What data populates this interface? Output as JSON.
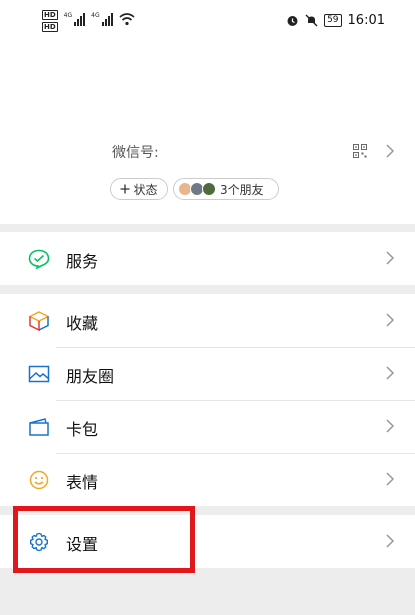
{
  "status_bar": {
    "hd1": "HD",
    "hd2": "HD",
    "net1": "4G",
    "net2": "4G",
    "battery": "59",
    "time": "16:01"
  },
  "profile": {
    "wechat_id_label": "微信号:",
    "status_button": "状态",
    "friends_count": "3个朋友"
  },
  "menu": {
    "services": "服务",
    "favorites": "收藏",
    "moments": "朋友圈",
    "cards": "卡包",
    "stickers": "表情",
    "settings": "设置"
  },
  "colors": {
    "accent_green": "#07c160",
    "icon_blue": "#1a73c9",
    "highlight_red": "#e1181b"
  }
}
